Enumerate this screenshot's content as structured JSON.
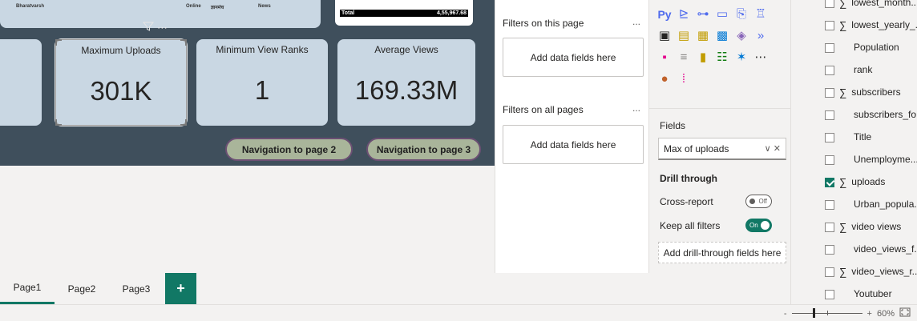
{
  "canvas": {
    "top_strip": {
      "left_text": "Bharatvarsh",
      "mid_text_1": "Online",
      "mid_text_2": "ज्ञानमंच",
      "mid_text_3": "News"
    },
    "top_table": {
      "total_label": "Total",
      "total_value": "4,55,967.68"
    },
    "cards": [
      {
        "title": "Maximum Uploads",
        "value": "301K"
      },
      {
        "title": "Minimum View Ranks",
        "value": "1"
      },
      {
        "title": "Average Views",
        "value": "169.33M"
      }
    ],
    "nav_buttons": [
      {
        "label": "Navigation to page 2"
      },
      {
        "label": "Navigation to page 3"
      }
    ]
  },
  "page_tabs": [
    {
      "label": "Page1",
      "active": true
    },
    {
      "label": "Page2",
      "active": false
    },
    {
      "label": "Page3",
      "active": false
    }
  ],
  "add_page_label": "+",
  "filters": {
    "on_this_page": "Filters on this page",
    "on_all_pages": "Filters on all pages",
    "add_fields": "Add data fields here",
    "more": "..."
  },
  "visualizations": {
    "fields_label": "Fields",
    "field_value": "Max of uploads",
    "drill_through": "Drill through",
    "cross_report": "Cross-report",
    "cross_report_state": "Off",
    "keep_all_filters": "Keep all filters",
    "keep_all_filters_state": "On",
    "add_drill": "Add drill-through fields here"
  },
  "data_fields": [
    {
      "name": "lowest_month...",
      "sigma": true,
      "checked": false
    },
    {
      "name": "lowest_yearly_...",
      "sigma": true,
      "checked": false
    },
    {
      "name": "Population",
      "sigma": false,
      "checked": false
    },
    {
      "name": "rank",
      "sigma": false,
      "checked": false
    },
    {
      "name": "subscribers",
      "sigma": true,
      "checked": false
    },
    {
      "name": "subscribers_fo...",
      "sigma": false,
      "checked": false
    },
    {
      "name": "Title",
      "sigma": false,
      "checked": false
    },
    {
      "name": "Unemployme...",
      "sigma": false,
      "checked": false
    },
    {
      "name": "uploads",
      "sigma": true,
      "checked": true
    },
    {
      "name": "Urban_popula...",
      "sigma": false,
      "checked": false
    },
    {
      "name": "video views",
      "sigma": true,
      "checked": false
    },
    {
      "name": "video_views_f...",
      "sigma": false,
      "checked": false
    },
    {
      "name": "video_views_r...",
      "sigma": true,
      "checked": false
    },
    {
      "name": "Youtuber",
      "sigma": false,
      "checked": false
    }
  ],
  "zoom": {
    "minus": "-",
    "plus": "+",
    "level": "60%"
  },
  "colors": {
    "accent": "#117865",
    "canvas_bg": "#3f4f5c",
    "card_bg": "#c9d7e3",
    "nav_btn_bg": "#a9b59a"
  }
}
